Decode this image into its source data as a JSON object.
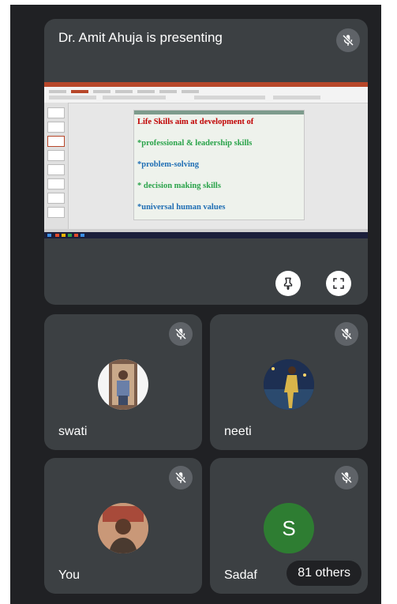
{
  "presentation": {
    "presenter_label": "Dr. Amit Ahuja is presenting",
    "slide_lines": [
      "Life Skills aim at development of",
      "*professional & leadership skills",
      "*problem-solving",
      "* decision making skills",
      "*universal human values"
    ]
  },
  "controls": {
    "pin_icon": "pin-icon",
    "fullscreen_icon": "fullscreen-icon",
    "mic_icon": "mic-off-icon"
  },
  "participants": [
    {
      "name": "swati",
      "avatar": "photo",
      "muted": true
    },
    {
      "name": "neeti",
      "avatar": "photo",
      "muted": true
    },
    {
      "name": "You",
      "avatar": "photo",
      "muted": true
    },
    {
      "name": "Sadaf",
      "avatar_letter": "S",
      "muted": true
    }
  ],
  "others_badge": "81 others",
  "colors": {
    "background": "#202124",
    "tile": "#3c4043",
    "mic_badge": "#5f6368",
    "sadaf_avatar": "#2e7d32",
    "slide_red": "#c00000",
    "slide_green": "#2aa34a",
    "slide_blue": "#1f6eb4"
  }
}
